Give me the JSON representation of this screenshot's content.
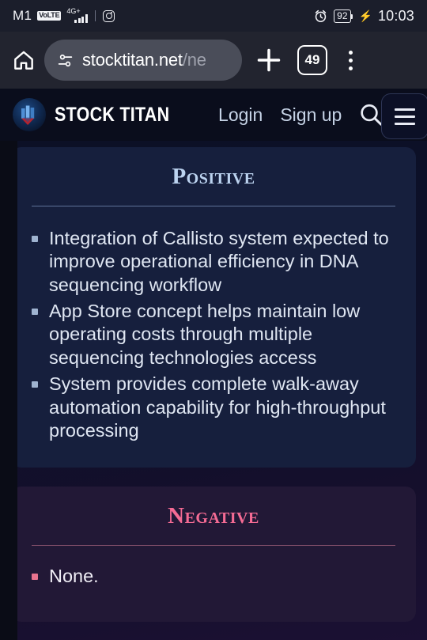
{
  "statusbar": {
    "carrier": "M1",
    "volte_badge": "VoLTE",
    "network_type": "4G+",
    "battery_percent": "92",
    "time": "10:03",
    "icons": [
      "volte-badge",
      "signal-bars-icon",
      "instagram-icon",
      "alarm-clock-icon",
      "battery-icon",
      "charging-bolt-icon"
    ]
  },
  "browser": {
    "home_icon": "home-icon",
    "site_settings_icon": "tune-icon",
    "url_main": "stocktitan.net",
    "url_path": "/ne",
    "new_tab_icon": "plus-icon",
    "tab_count": "49",
    "menu_icon": "kebab-menu-icon"
  },
  "site_header": {
    "logo": "stock-titan-logo",
    "brand": "STOCK TITAN",
    "login_label": "Login",
    "signup_label": "Sign up",
    "search_icon": "search-icon",
    "menu_icon": "hamburger-menu-icon"
  },
  "content": {
    "positive": {
      "title": "Positive",
      "accent_color": "#bcd3f0",
      "bullets": [
        "Integration of Callisto system expected to improve operational efficiency in DNA sequencing workflow",
        "App Store concept helps maintain low operating costs through multiple sequencing technologies access",
        "System provides complete walk-away automation capability for high-throughput processing"
      ]
    },
    "negative": {
      "title": "Negative",
      "accent_color": "#f56b94",
      "bullets": [
        "None."
      ]
    }
  }
}
